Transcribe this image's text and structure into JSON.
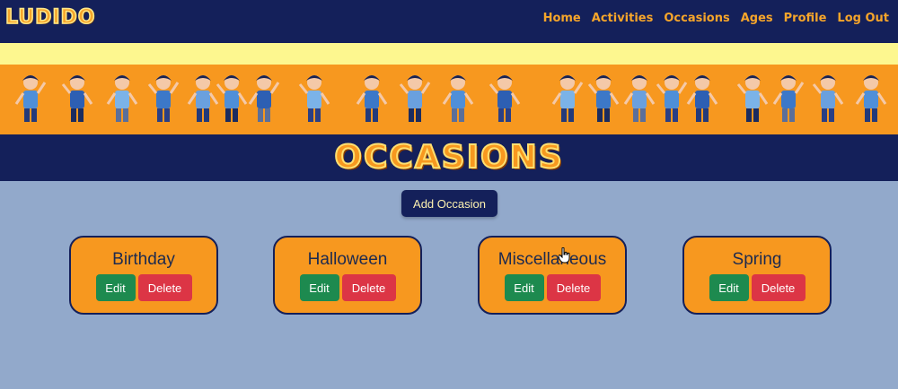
{
  "brand": {
    "name": "LUDIDO"
  },
  "nav": {
    "links": [
      "Home",
      "Activities",
      "Occasions",
      "Ages",
      "Profile",
      "Log Out"
    ]
  },
  "page": {
    "title": "OCCASIONS"
  },
  "actions": {
    "add_label": "Add Occasion"
  },
  "occasions": [
    {
      "name": "Birthday",
      "edit": "Edit",
      "delete": "Delete"
    },
    {
      "name": "Halloween",
      "edit": "Edit",
      "delete": "Delete"
    },
    {
      "name": "Miscellaneous",
      "edit": "Edit",
      "delete": "Delete"
    },
    {
      "name": "Spring",
      "edit": "Edit",
      "delete": "Delete"
    }
  ],
  "colors": {
    "navbar": "#14205a",
    "accent": "#f7981f",
    "banner_yellow": "#fdf78f",
    "background": "#92a9cb",
    "edit": "#1d8a4f",
    "delete": "#dc3545"
  }
}
